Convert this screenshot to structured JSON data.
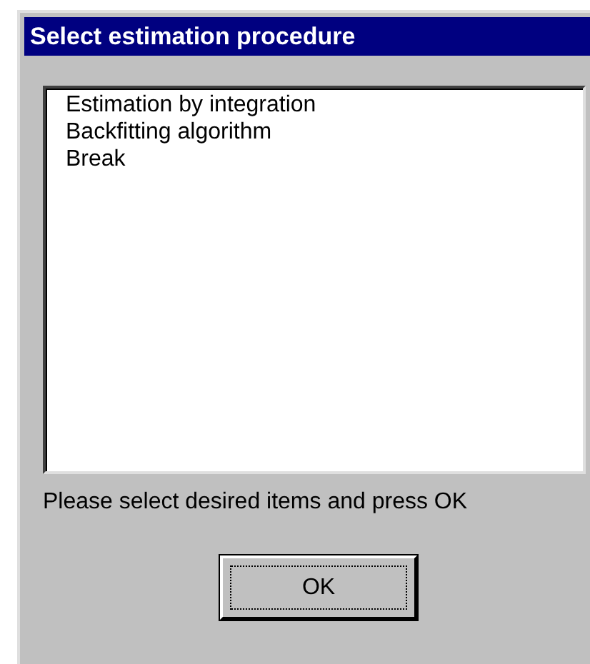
{
  "window": {
    "title": "Select estimation procedure"
  },
  "list": {
    "items": [
      {
        "label": "Estimation by integration",
        "selected": false
      },
      {
        "label": "Backfitting algorithm",
        "selected": false
      },
      {
        "label": "Break",
        "selected": false
      }
    ]
  },
  "message": "Please select desired items and press OK",
  "buttons": [
    {
      "label": "OK",
      "focused": true
    }
  ]
}
